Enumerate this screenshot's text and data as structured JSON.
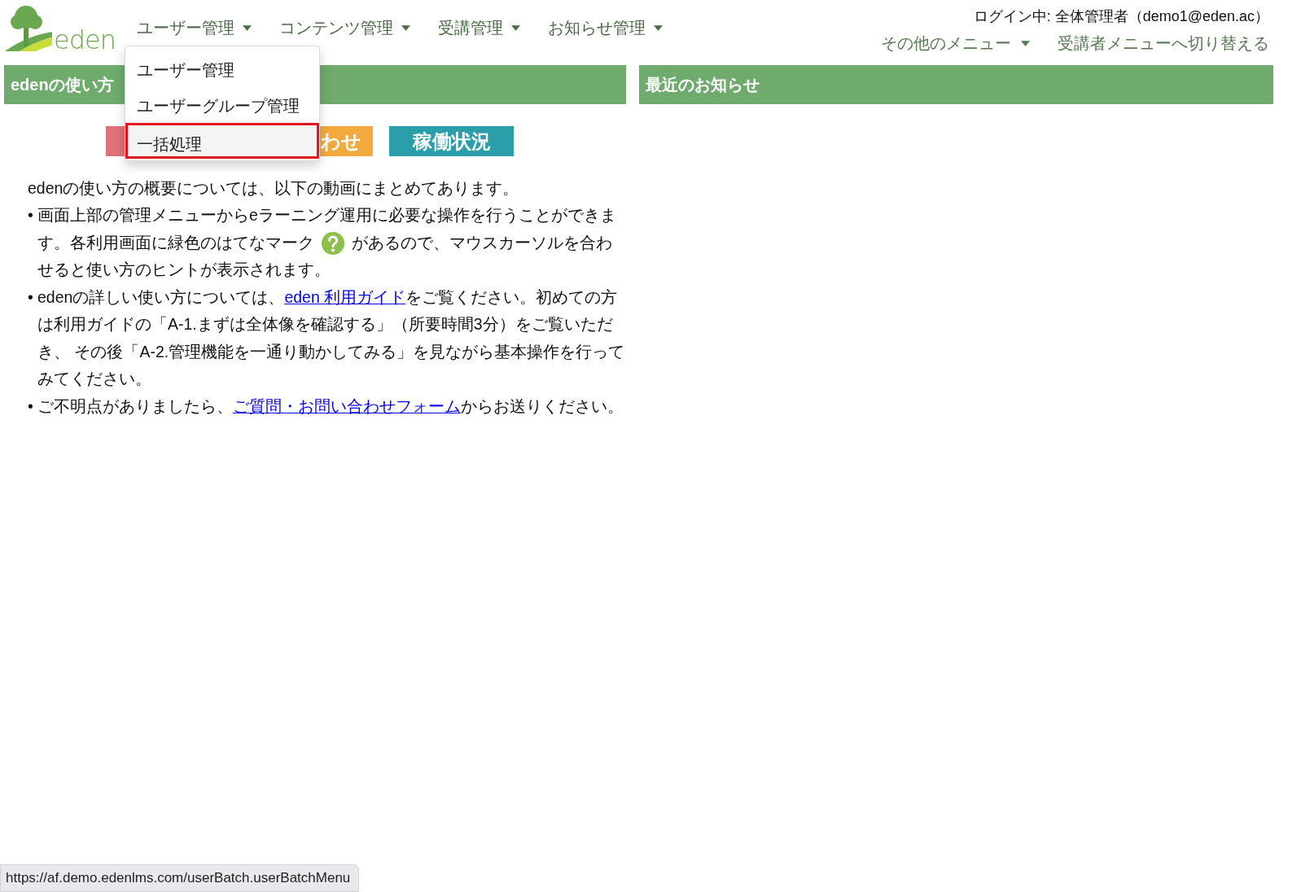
{
  "logo": {
    "text": "eden"
  },
  "nav": [
    {
      "label": "ユーザー管理"
    },
    {
      "label": "コンテンツ管理"
    },
    {
      "label": "受講管理"
    },
    {
      "label": "お知らせ管理"
    }
  ],
  "dropdown": {
    "items": [
      {
        "label": "ユーザー管理",
        "selected": false
      },
      {
        "label": "ユーザーグループ管理",
        "selected": false
      },
      {
        "label": "一括処理",
        "selected": true
      }
    ]
  },
  "login": "ログイン中: 全体管理者（demo1@eden.ac）",
  "sub_nav": [
    {
      "label": "その他のメニュー",
      "kind": "menu"
    },
    {
      "label": "受講者メニューへ切り替える",
      "kind": "link"
    }
  ],
  "left_panel": {
    "title": "edenの使い方",
    "buttons": [
      {
        "color": "#e27078"
      },
      {
        "label": "わせ",
        "color": "#f2aa3e"
      },
      {
        "label": "稼働状況",
        "color": "#2a9fa9"
      }
    ],
    "intro": "edenの使い方の概要については、以下の動画にまとめてあります。",
    "bullets": [
      {
        "marker": "•",
        "parts": [
          {
            "kind": "text",
            "text": "画面上部の管理メニューからeラーニング運用に必要な操作を行うことができます。各利用画面に緑色のはてなマーク"
          },
          {
            "kind": "help_icon"
          },
          {
            "kind": "text",
            "text": "があるので、マウスカーソルを合わせると使い方のヒントが表示されます。"
          }
        ]
      },
      {
        "marker": "•",
        "parts": [
          {
            "kind": "text",
            "text": "edenの詳しい使い方については、"
          },
          {
            "kind": "link",
            "text": "eden 利用ガイド"
          },
          {
            "kind": "text",
            "text": "をご覧ください。初めての方は利用ガイドの「A-1.まずは全体像を確認する」（所要時間3分）をご覧いただき、 その後「A-2.管理機能を一通り動かしてみる」を見ながら基本操作を行ってみてください。"
          }
        ]
      },
      {
        "marker": "•",
        "parts": [
          {
            "kind": "text",
            "text": "ご不明点がありましたら、"
          },
          {
            "kind": "link",
            "text": "ご質問・お問い合わせフォーム"
          },
          {
            "kind": "text",
            "text": "からお送りください。"
          }
        ]
      }
    ]
  },
  "right_panel": {
    "title": "最近のお知らせ"
  },
  "status_url": "https://af.demo.edenlms.com/userBatch.userBatchMenu"
}
